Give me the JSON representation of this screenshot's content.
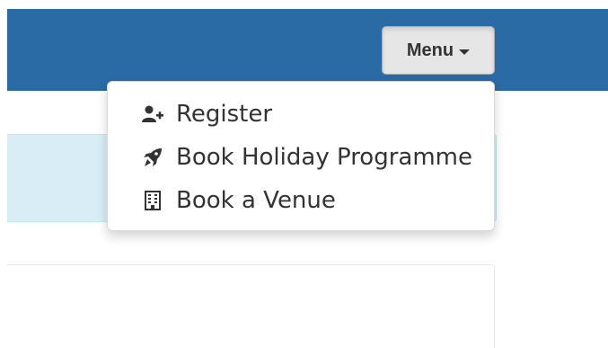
{
  "navbar": {
    "menu_label": "Menu",
    "color": "#2a6aa5"
  },
  "dropdown": {
    "items": [
      {
        "label": "Register",
        "icon": "user-plus-icon"
      },
      {
        "label": "Book Holiday Programme",
        "icon": "rocket-icon"
      },
      {
        "label": "Book a Venue",
        "icon": "building-icon"
      }
    ]
  },
  "colors": {
    "info_panel_bg": "#d9edf7",
    "text": "#333333",
    "menu_button_bg": "#e6e6e6"
  }
}
